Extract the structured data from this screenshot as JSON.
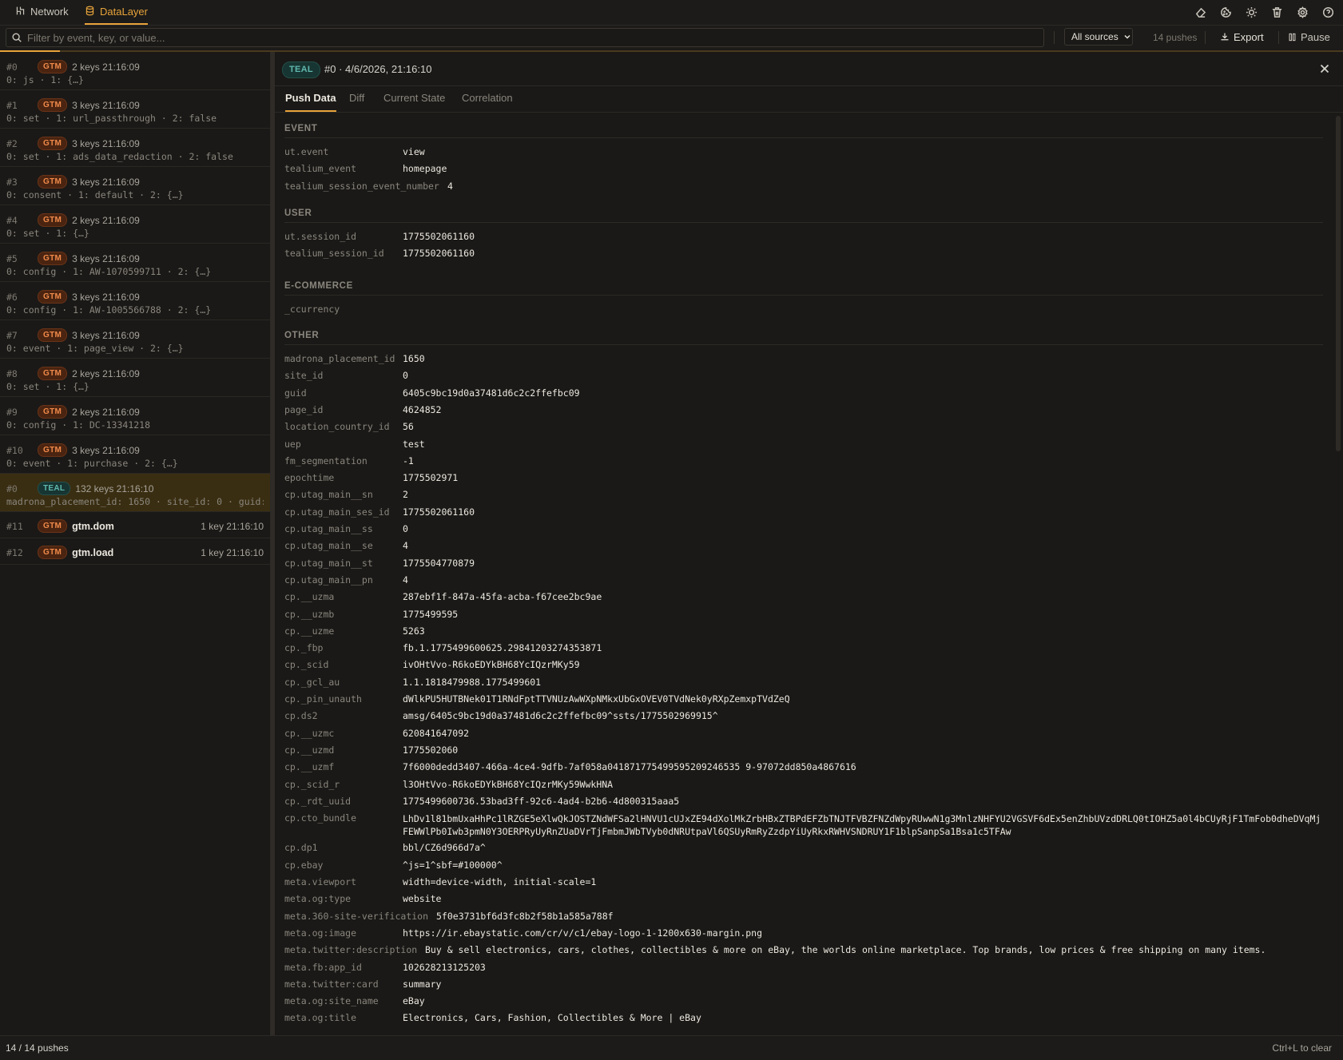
{
  "topbar": {
    "tabs": [
      {
        "label": "Network",
        "icon": "network-icon"
      },
      {
        "label": "DataLayer",
        "icon": "database-icon"
      }
    ],
    "icons": [
      "eraser-icon",
      "cookie-icon",
      "sun-icon",
      "trash-icon",
      "gear-icon",
      "help-icon"
    ]
  },
  "filter": {
    "placeholder": "Filter by event, key, or value...",
    "source": "All sources",
    "push_count": "14 pushes",
    "export_label": "Export",
    "pause_label": "Pause"
  },
  "list": [
    {
      "idx": "#0",
      "badge": "GTM",
      "meta": "2 keys 21:16:09",
      "summary": "0: js · 1: {…}"
    },
    {
      "idx": "#1",
      "badge": "GTM",
      "meta": "3 keys 21:16:09",
      "summary": "0: set · 1: url_passthrough · 2: false"
    },
    {
      "idx": "#2",
      "badge": "GTM",
      "meta": "3 keys 21:16:09",
      "summary": "0: set · 1: ads_data_redaction · 2: false"
    },
    {
      "idx": "#3",
      "badge": "GTM",
      "meta": "3 keys 21:16:09",
      "summary": "0: consent · 1: default · 2: {…}"
    },
    {
      "idx": "#4",
      "badge": "GTM",
      "meta": "2 keys 21:16:09",
      "summary": "0: set · 1: {…}"
    },
    {
      "idx": "#5",
      "badge": "GTM",
      "meta": "3 keys 21:16:09",
      "summary": "0: config · 1: AW-1070599711 · 2: {…}"
    },
    {
      "idx": "#6",
      "badge": "GTM",
      "meta": "3 keys 21:16:09",
      "summary": "0: config · 1: AW-1005566788 · 2: {…}"
    },
    {
      "idx": "#7",
      "badge": "GTM",
      "meta": "3 keys 21:16:09",
      "summary": "0: event · 1: page_view · 2: {…}"
    },
    {
      "idx": "#8",
      "badge": "GTM",
      "meta": "2 keys 21:16:09",
      "summary": "0: set · 1: {…}"
    },
    {
      "idx": "#9",
      "badge": "GTM",
      "meta": "2 keys 21:16:09",
      "summary": "0: config · 1: DC-13341218"
    },
    {
      "idx": "#10",
      "badge": "GTM",
      "meta": "3 keys 21:16:09",
      "summary": "0: event · 1: purchase · 2: {…}"
    },
    {
      "idx": "#0",
      "badge": "TEAL",
      "meta": "132 keys 21:16:10",
      "summary": "madrona_placement_id: 1650 · site_id: 0 · guid:…"
    }
  ],
  "list_events": [
    {
      "idx": "#11",
      "badge": "GTM",
      "event": "gtm.dom",
      "meta": "1 key 21:16:10"
    },
    {
      "idx": "#12",
      "badge": "GTM",
      "event": "gtm.load",
      "meta": "1 key 21:16:10"
    }
  ],
  "detail": {
    "badge": "TEAL",
    "title": "#0 · 4/6/2026, 21:16:10",
    "tabs": [
      "Push Data",
      "Diff",
      "Current State",
      "Correlation"
    ],
    "sections": {
      "event": {
        "title": "EVENT",
        "rows": [
          {
            "k": "ut.event",
            "v": "view"
          },
          {
            "k": "tealium_event",
            "v": "homepage"
          },
          {
            "k": "tealium_session_event_number",
            "v": "4"
          }
        ]
      },
      "user": {
        "title": "USER",
        "rows": [
          {
            "k": "ut.session_id",
            "v": "1775502061160"
          },
          {
            "k": "tealium_session_id",
            "v": "1775502061160"
          }
        ]
      },
      "ecommerce": {
        "title": "E-COMMERCE",
        "rows": [
          {
            "k": "_ccurrency",
            "v": ""
          }
        ]
      },
      "other": {
        "title": "OTHER",
        "rows": [
          {
            "k": "madrona_placement_id",
            "v": "1650"
          },
          {
            "k": "site_id",
            "v": "0"
          },
          {
            "k": "guid",
            "v": "6405c9bc19d0a37481d6c2c2ffefbc09"
          },
          {
            "k": "page_id",
            "v": "4624852"
          },
          {
            "k": "location_country_id",
            "v": "56"
          },
          {
            "k": "uep",
            "v": "test"
          },
          {
            "k": "fm_segmentation",
            "v": "-1"
          },
          {
            "k": "epochtime",
            "v": "1775502971"
          },
          {
            "k": "cp.utag_main__sn",
            "v": "2"
          },
          {
            "k": "cp.utag_main_ses_id",
            "v": "1775502061160"
          },
          {
            "k": "cp.utag_main__ss",
            "v": "0"
          },
          {
            "k": "cp.utag_main__se",
            "v": "4"
          },
          {
            "k": "cp.utag_main__st",
            "v": "1775504770879"
          },
          {
            "k": "cp.utag_main__pn",
            "v": "4"
          },
          {
            "k": "cp.__uzma",
            "v": "287ebf1f-847a-45fa-acba-f67cee2bc9ae"
          },
          {
            "k": "cp.__uzmb",
            "v": "1775499595"
          },
          {
            "k": "cp.__uzme",
            "v": "5263"
          },
          {
            "k": "cp._fbp",
            "v": "fb.1.1775499600625.29841203274353871"
          },
          {
            "k": "cp._scid",
            "v": "ivOHtVvo-R6koEDYkBH68YcIQzrMKy59"
          },
          {
            "k": "cp._gcl_au",
            "v": "1.1.1818479988.1775499601"
          },
          {
            "k": "cp._pin_unauth",
            "v": "dWlkPU5HUTBNek01T1RNdFptTTVNUzAwWXpNMkxUbGxOVEV0TVdNek0yRXpZemxpTVdZeQ"
          },
          {
            "k": "cp.ds2",
            "v": "amsg/6405c9bc19d0a37481d6c2c2ffefbc09^ssts/1775502969915^"
          },
          {
            "k": "cp.__uzmc",
            "v": "620841647092"
          },
          {
            "k": "cp.__uzmd",
            "v": "1775502060"
          },
          {
            "k": "cp.__uzmf",
            "v": "7f6000dedd3407-466a-4ce4-9dfb-7af058a041871775499595209246535 9-97072dd850a4867616"
          },
          {
            "k": "cp._scid_r",
            "v": "l3OHtVvo-R6koEDYkBH68YcIQzrMKy59WwkHNA"
          },
          {
            "k": "cp._rdt_uuid",
            "v": "1775499600736.53bad3ff-92c6-4ad4-b2b6-4d800315aaa5"
          },
          {
            "k": "cp.cto_bundle",
            "v": "LhDv1l81bmUxaHhPc1lRZGE5eXlwQkJOSTZNdWFSa2lHNVU1cUJxZE94dXolMkZrbHBxZTBPdEFZbTNJTFVBZFNZdWpyRUwwN1g3MnlzNHFYU2VGSVF6dEx5enZhbUVzdDRLQ0tIOHZ5a0l4bCUyRjF1TmFob0dheDVqMjFEWWlPb0Iwb3pmN0Y3OERPRyUyRnZUaDVrTjFmbmJWbTVyb0dNRUtpaVl6QSUyRmRyZzdpYiUyRkxRWHVSNDRUY1F1blpSanpSa1Bsa1c5TFAw",
            "wrap": true
          },
          {
            "k": "cp.dp1",
            "v": "bbl/CZ6d966d7a^"
          },
          {
            "k": "cp.ebay",
            "v": "^js=1^sbf=#100000^"
          },
          {
            "k": "meta.viewport",
            "v": "width=device-width, initial-scale=1"
          },
          {
            "k": "meta.og:type",
            "v": "website"
          },
          {
            "k": "meta.360-site-verification",
            "v": "5f0e3731bf6d3fc8b2f58b1a585a788f"
          },
          {
            "k": "meta.og:image",
            "v": "https://ir.ebaystatic.com/cr/v/c1/ebay-logo-1-1200x630-margin.png"
          },
          {
            "k": "meta.twitter:description",
            "v": "Buy & sell electronics, cars, clothes, collectibles & more on eBay, the worlds online marketplace. Top brands, low prices & free shipping on many items."
          },
          {
            "k": "meta.fb:app_id",
            "v": "102628213125203"
          },
          {
            "k": "meta.twitter:card",
            "v": "summary"
          },
          {
            "k": "meta.og:site_name",
            "v": "eBay"
          },
          {
            "k": "meta.og:title",
            "v": "Electronics, Cars, Fashion, Collectibles & More | eBay"
          }
        ]
      }
    }
  },
  "footer": {
    "count": "14 / 14 pushes",
    "hint": "Ctrl+L to clear"
  }
}
